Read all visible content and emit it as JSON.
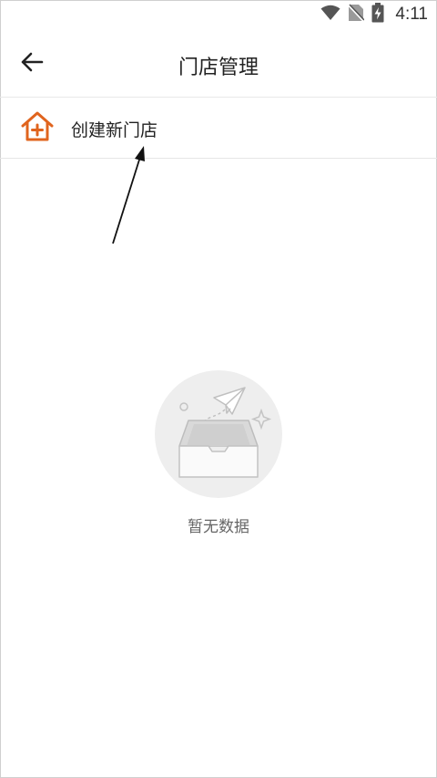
{
  "status_bar": {
    "time": "4:11",
    "icons": [
      "wifi-icon",
      "no-sim-icon",
      "battery-charging-icon"
    ]
  },
  "app_bar": {
    "title": "门店管理",
    "back_icon": "back-arrow-icon"
  },
  "create_store": {
    "label": "创建新门店",
    "icon": "house-plus-icon",
    "accent_color": "#E0641E"
  },
  "empty_state": {
    "text": "暂无数据",
    "illustration": "empty-box-paper-plane-icon"
  }
}
